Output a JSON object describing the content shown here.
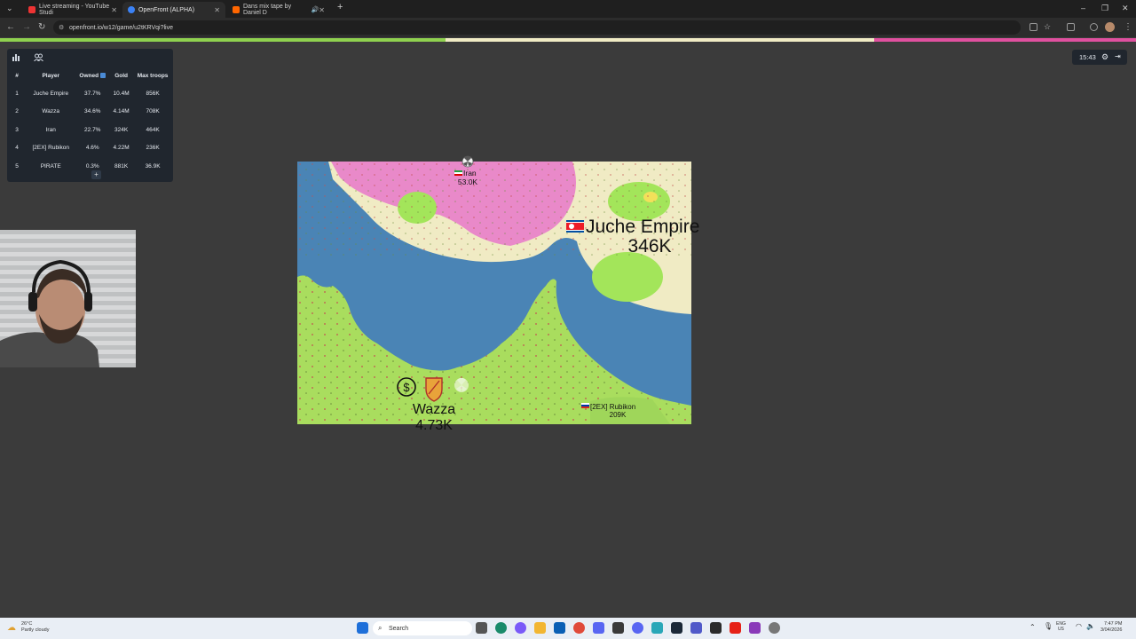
{
  "browser": {
    "tabs": [
      {
        "title": "Live streaming - YouTube Studi",
        "favicon_color": "#e33"
      },
      {
        "title": "OpenFront (ALPHA)",
        "favicon_color": "#3b82f6"
      },
      {
        "title": "Dans mix tape by Daniel D",
        "favicon_color": "#f60"
      }
    ],
    "url": "openfront.io/w12/game/u2tKRVqi?live"
  },
  "leaderboard": {
    "headers": [
      "#",
      "Player",
      "Owned",
      "Gold",
      "Max troops"
    ],
    "rows": [
      {
        "rank": "1",
        "player": "Juche Empire",
        "owned": "37.7%",
        "gold": "10.4M",
        "troops": "856K"
      },
      {
        "rank": "2",
        "player": "Wazza",
        "owned": "34.6%",
        "gold": "4.14M",
        "troops": "708K"
      },
      {
        "rank": "3",
        "player": "Iran",
        "owned": "22.7%",
        "gold": "324K",
        "troops": "464K"
      },
      {
        "rank": "4",
        "player": "[2EX] Rubikon",
        "owned": "4.6%",
        "gold": "4.22M",
        "troops": "236K"
      },
      {
        "rank": "5",
        "player": "PIRATE",
        "owned": "0.3%",
        "gold": "881K",
        "troops": "36.9K"
      }
    ],
    "expand_label": "+"
  },
  "timer": "15:43",
  "map": {
    "players": [
      {
        "name": "Iran",
        "troops": "53.0K"
      },
      {
        "name": "Juche Empire",
        "troops": "346K"
      },
      {
        "name": "Wazza",
        "troops": "4.73K"
      },
      {
        "name": "[2EX] Rubikon",
        "troops": "209K"
      }
    ],
    "colors": {
      "ocean": "#4a84b5",
      "wazza": "#a9dd5e",
      "iran": "#e989c9",
      "juche": "#f0ebc4",
      "neutral": "#ece8cf"
    }
  },
  "taskbar": {
    "weather_temp": "26°C",
    "weather_desc": "Partly cloudy",
    "search": "Search",
    "lang1": "ENG",
    "lang2": "US",
    "time": "7:47 PM",
    "date": "3/04/2026"
  }
}
